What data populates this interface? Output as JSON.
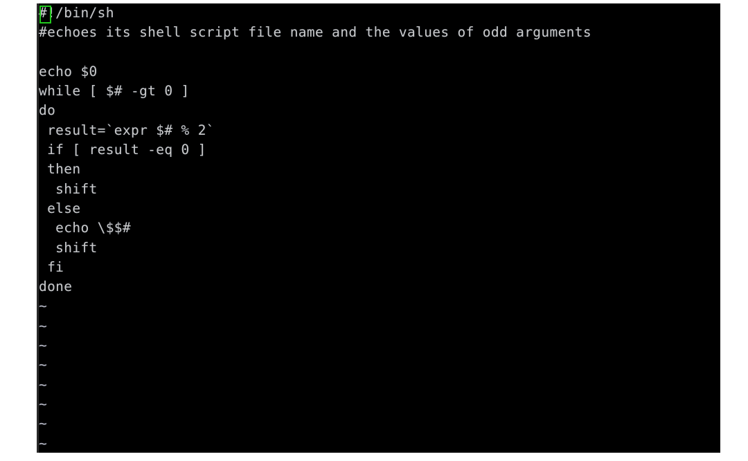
{
  "app": {
    "type": "terminal",
    "editor": "vi",
    "background_color": "#000000",
    "text_color": "#c8c8c8",
    "page_background": "#ffffff"
  },
  "cursor": {
    "color": "#22c81e",
    "style": "outlined-block",
    "row": 1,
    "column": 1,
    "char_under": "#"
  },
  "buffer": {
    "lines": [
      {
        "text": "#!/bin/sh",
        "kind": "code"
      },
      {
        "text": "#echoes its shell script file name and the values of odd arguments",
        "kind": "code"
      },
      {
        "text": "",
        "kind": "blank"
      },
      {
        "text": "echo $0",
        "kind": "code"
      },
      {
        "text": "while [ $# -gt 0 ]",
        "kind": "code"
      },
      {
        "text": "do",
        "kind": "code"
      },
      {
        "text": " result=`expr $# % 2`",
        "kind": "code"
      },
      {
        "text": " if [ result -eq 0 ]",
        "kind": "code"
      },
      {
        "text": " then",
        "kind": "code"
      },
      {
        "text": "  shift",
        "kind": "code"
      },
      {
        "text": " else",
        "kind": "code"
      },
      {
        "text": "  echo \\$$#",
        "kind": "code"
      },
      {
        "text": "  shift",
        "kind": "code"
      },
      {
        "text": " fi",
        "kind": "code"
      },
      {
        "text": "done",
        "kind": "code"
      },
      {
        "text": "~",
        "kind": "tilde"
      },
      {
        "text": "~",
        "kind": "tilde"
      },
      {
        "text": "~",
        "kind": "tilde"
      },
      {
        "text": "~",
        "kind": "tilde"
      },
      {
        "text": "~",
        "kind": "tilde"
      },
      {
        "text": "~",
        "kind": "tilde"
      },
      {
        "text": "~",
        "kind": "tilde"
      },
      {
        "text": "~",
        "kind": "tilde"
      }
    ]
  }
}
